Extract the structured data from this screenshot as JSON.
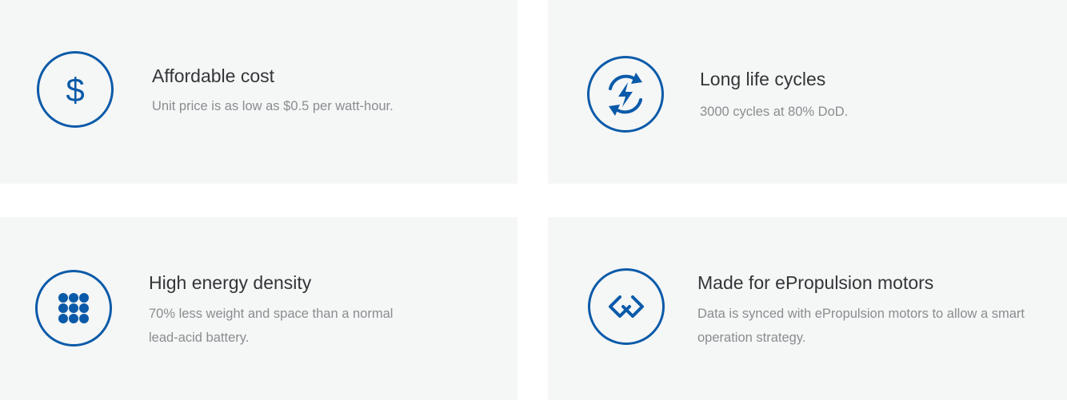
{
  "brand": {
    "accent": "#0a5aa9",
    "card_bg": "#f5f6f6"
  },
  "features": [
    {
      "icon": "dollar-icon",
      "title": "Affordable cost",
      "description": "Unit price is as low as $0.5 per watt-hour."
    },
    {
      "icon": "recycle-bolt-icon",
      "title": "Long life cycles",
      "description": "3000 cycles at 80% DoD."
    },
    {
      "icon": "cell-grid-icon",
      "title": "High energy density",
      "description": "70% less weight and space than a normal lead-acid battery."
    },
    {
      "icon": "link-chain-icon",
      "title": "Made for ePropulsion motors",
      "description": "Data is synced with ePropulsion motors to allow a smart operation strategy."
    }
  ]
}
